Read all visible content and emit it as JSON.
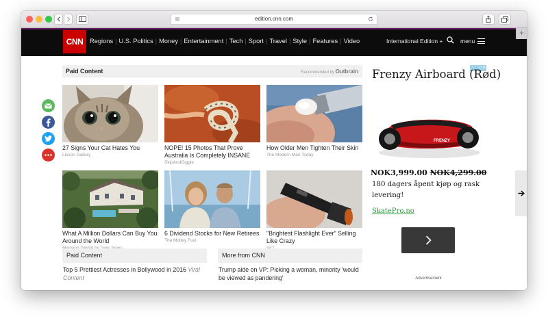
{
  "browser": {
    "url": "edition.cnn.com"
  },
  "nav": {
    "logo": "CNN",
    "links": [
      "Regions",
      "U.S. Politics",
      "Money",
      "Entertainment",
      "Tech",
      "Sport",
      "Travel",
      "Style",
      "Features",
      "Video"
    ],
    "edition": "International Edition +",
    "menu": "menu"
  },
  "paid_content": {
    "title": "Paid Content",
    "recommended": "Recommended by",
    "brand": "Outbrain",
    "cards": [
      {
        "caption": "27 Signs Your Cat Hates You",
        "source": "Lisson Gallery"
      },
      {
        "caption": "NOPE! 15 Photos That Prove Australia Is Completely INSANE",
        "source": "SkipAndGiggle"
      },
      {
        "caption": "How Older Men Tighten Their Skin",
        "source": "The Modern Man Today"
      },
      {
        "caption": "What A Million Dollars Can Buy You Around the World",
        "source": "Mansion Global by Dow Jones"
      },
      {
        "caption": "6 Dividend Stocks for New Retirees",
        "source": "The Motley Fool"
      },
      {
        "caption": "\"Brightest Flashlight Ever\" Selling Like Crazy",
        "source": "Vir2"
      }
    ]
  },
  "bottom": {
    "paid_title": "Paid Content",
    "paid_item": "Top 5 Prettiest Actresses in Bollywood in 2016",
    "paid_item_source": "Viral Content",
    "more_title": "More from CNN",
    "more_item": "Trump aide on VP: Picking a woman, minority 'would be viewed as pandering'"
  },
  "ad": {
    "title": "Frenzy Airboard (Rød)",
    "product_brand": "FRENZY",
    "price": "NOK3,999.00",
    "old_price": "NOK4,299.00",
    "description": "180 dagers åpent kjøp og rask levering!",
    "link": "SkatePro.no",
    "label": "Advertisement"
  },
  "colors": {
    "cnn_red": "#cc0000",
    "nav_bg": "#0c0c0c",
    "email": "#5cb85c",
    "facebook": "#3b5998",
    "twitter": "#1da1f2",
    "more": "#d9332b",
    "ad_link": "#2d9e3a"
  }
}
